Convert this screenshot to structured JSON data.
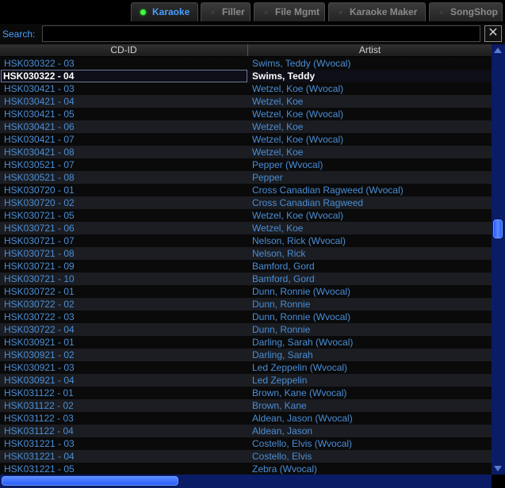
{
  "tabs": [
    {
      "label": "Karaoke",
      "active": true
    },
    {
      "label": "Filler",
      "active": false
    },
    {
      "label": "File Mgmt",
      "active": false
    },
    {
      "label": "Karaoke Maker",
      "active": false
    },
    {
      "label": "SongShop",
      "active": false
    }
  ],
  "search": {
    "label": "Search:",
    "value": "",
    "clear_glyph": "✕"
  },
  "table": {
    "columns": [
      "CD-ID",
      "Artist"
    ],
    "selected_index": 1,
    "rows": [
      [
        "HSK030322 - 03",
        "Swims, Teddy (Wvocal)"
      ],
      [
        "HSK030322 - 04",
        "Swims, Teddy"
      ],
      [
        "HSK030421 - 03",
        "Wetzel, Koe (Wvocal)"
      ],
      [
        "HSK030421 - 04",
        "Wetzel, Koe"
      ],
      [
        "HSK030421 - 05",
        "Wetzel, Koe (Wvocal)"
      ],
      [
        "HSK030421 - 06",
        "Wetzel, Koe"
      ],
      [
        "HSK030421 - 07",
        "Wetzel, Koe (Wvocal)"
      ],
      [
        "HSK030421 - 08",
        "Wetzel, Koe"
      ],
      [
        "HSK030521 - 07",
        "Pepper (Wvocal)"
      ],
      [
        "HSK030521 - 08",
        "Pepper"
      ],
      [
        "HSK030720 - 01",
        "Cross Canadian Ragweed (Wvocal)"
      ],
      [
        "HSK030720 - 02",
        "Cross Canadian Ragweed"
      ],
      [
        "HSK030721 - 05",
        "Wetzel, Koe (Wvocal)"
      ],
      [
        "HSK030721 - 06",
        "Wetzel, Koe"
      ],
      [
        "HSK030721 - 07",
        "Nelson, Rick (Wvocal)"
      ],
      [
        "HSK030721 - 08",
        "Nelson, Rick"
      ],
      [
        "HSK030721 - 09",
        "Bamford, Gord"
      ],
      [
        "HSK030721 - 10",
        "Bamford, Gord"
      ],
      [
        "HSK030722 - 01",
        "Dunn, Ronnie (Wvocal)"
      ],
      [
        "HSK030722 - 02",
        "Dunn, Ronnie"
      ],
      [
        "HSK030722 - 03",
        "Dunn, Ronnie (Wvocal)"
      ],
      [
        "HSK030722 - 04",
        "Dunn, Ronnie"
      ],
      [
        "HSK030921 - 01",
        "Darling, Sarah (Wvocal)"
      ],
      [
        "HSK030921 - 02",
        "Darling, Sarah"
      ],
      [
        "HSK030921 - 03",
        "Led Zeppelin (Wvocal)"
      ],
      [
        "HSK030921 - 04",
        "Led Zeppelin"
      ],
      [
        "HSK031122 - 01",
        "Brown, Kane (Wvocal)"
      ],
      [
        "HSK031122 - 02",
        "Brown, Kane"
      ],
      [
        "HSK031122 - 03",
        "Aldean, Jason (Wvocal)"
      ],
      [
        "HSK031122 - 04",
        "Aldean, Jason"
      ],
      [
        "HSK031221 - 03",
        "Costello, Elvis (Wvocal)"
      ],
      [
        "HSK031221 - 04",
        "Costello, Elvis"
      ],
      [
        "HSK031221 - 05",
        "Zebra (Wvocal)"
      ]
    ]
  },
  "scroll": {
    "vertical_position": 0.42,
    "horizontal_fraction": 0.36
  },
  "colors": {
    "accent": "#4a9eff",
    "row_text": "#4a8ed6",
    "scrollbar": "#0a1c66",
    "active_dot": "#3cff3c"
  },
  "icons": {
    "clear": "close-icon",
    "tab_indicator": "status-dot-icon"
  }
}
